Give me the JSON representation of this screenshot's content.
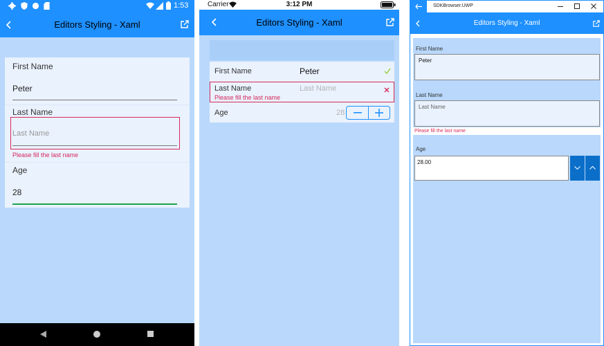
{
  "android": {
    "status": {
      "time": "1:53"
    },
    "appbar": {
      "title": "Editors Styling - Xaml"
    },
    "first_name": {
      "label": "First Name",
      "value": "Peter"
    },
    "last_name": {
      "label": "Last Name",
      "placeholder": "Last Name",
      "error": "Please fill the last name"
    },
    "age": {
      "label": "Age",
      "value": "28"
    }
  },
  "ios": {
    "status": {
      "carrier": "Carrier",
      "time": "3:12 PM"
    },
    "appbar": {
      "title": "Editors Styling - Xaml"
    },
    "first_name": {
      "label": "First Name",
      "value": "Peter"
    },
    "last_name": {
      "label": "Last Name",
      "placeholder": "Last Name",
      "error": "Please fill the last name"
    },
    "age": {
      "label": "Age",
      "value": "28"
    }
  },
  "uwp": {
    "window_title": "SDKBrowser.UWP",
    "appbar": {
      "title": "Editors Styling - Xaml"
    },
    "first_name": {
      "label": "First Name",
      "value": "Peter"
    },
    "last_name": {
      "label": "Last Name",
      "placeholder": "Last Name",
      "error": "Please fill the last name"
    },
    "age": {
      "label": "Age",
      "value": "28.00"
    }
  },
  "colors": {
    "accent": "#1e90ff",
    "background": "#b9d8fb",
    "error": "#d6285b",
    "valid": "#9bd045",
    "focus_line": "#1aa152"
  },
  "icons": [
    "gear-icon",
    "shield-icon",
    "circle-icon",
    "sd-card-icon",
    "wifi-icon",
    "signal-icon",
    "battery-icon",
    "back-chevron-icon",
    "open-external-icon",
    "checkmark-icon",
    "close-x-icon",
    "minus-icon",
    "plus-icon",
    "chevron-down-icon",
    "chevron-up-icon",
    "back-arrow-icon",
    "minimize-icon",
    "maximize-icon",
    "window-close-icon",
    "nav-back-triangle-icon",
    "nav-home-circle-icon",
    "nav-recents-square-icon"
  ]
}
